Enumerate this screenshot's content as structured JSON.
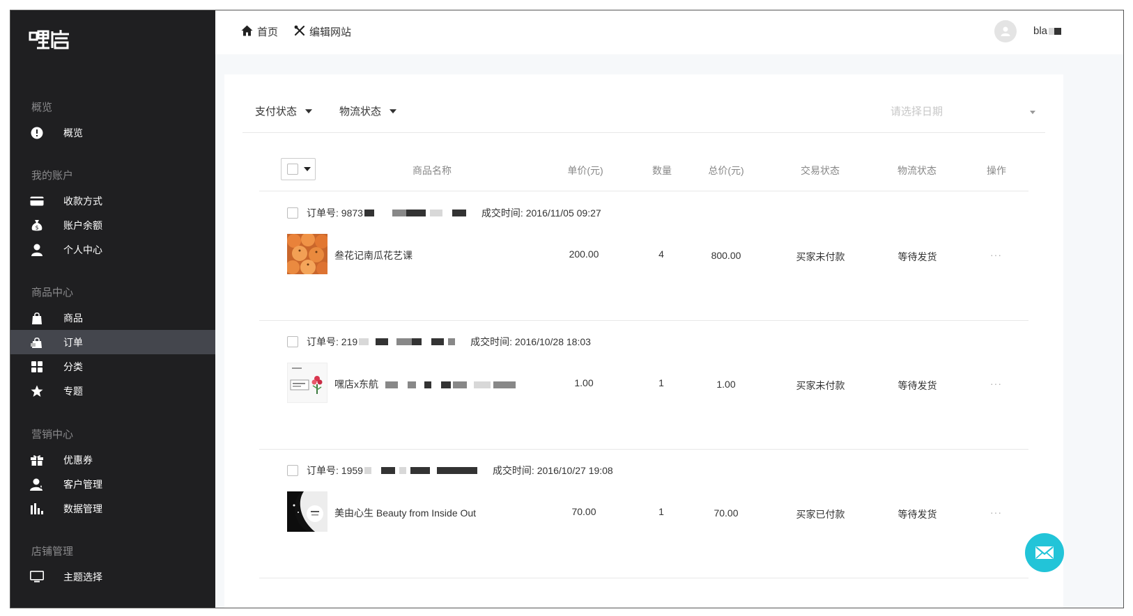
{
  "brand": {
    "logo_text": "嘿店"
  },
  "sidebar": {
    "sections": [
      {
        "title": "概览",
        "items": [
          {
            "label": "概览",
            "icon": "info-icon"
          }
        ]
      },
      {
        "title": "我的账户",
        "items": [
          {
            "label": "收款方式",
            "icon": "card-icon"
          },
          {
            "label": "账户余额",
            "icon": "money-bag-icon"
          },
          {
            "label": "个人中心",
            "icon": "user-icon"
          }
        ]
      },
      {
        "title": "商品中心",
        "items": [
          {
            "label": "商品",
            "icon": "shopping-bag-icon"
          },
          {
            "label": "订单",
            "icon": "orders-icon",
            "active": true
          },
          {
            "label": "分类",
            "icon": "grid-icon"
          },
          {
            "label": "专题",
            "icon": "star-icon"
          }
        ]
      },
      {
        "title": "营销中心",
        "items": [
          {
            "label": "优惠券",
            "icon": "gift-icon"
          },
          {
            "label": "客户管理",
            "icon": "customers-icon"
          },
          {
            "label": "数据管理",
            "icon": "bar-chart-icon"
          }
        ]
      },
      {
        "title": "店铺管理",
        "items": [
          {
            "label": "主题选择",
            "icon": "monitor-icon"
          }
        ]
      }
    ]
  },
  "topbar": {
    "home_label": "首页",
    "edit_label": "编辑网站",
    "username": "bla"
  },
  "filters": {
    "payment_status": "支付状态",
    "shipping_status": "物流状态",
    "date_placeholder": "请选择日期"
  },
  "table": {
    "headers": {
      "name": "商品名称",
      "unit_price": "单价(元)",
      "qty": "数量",
      "total": "总价(元)",
      "trade_status": "交易状态",
      "ship_status": "物流状态",
      "actions": "操作"
    }
  },
  "orders": [
    {
      "order_no_label": "订单号: 9873",
      "time_label": "成交时间: 2016/11/05 09:27",
      "product": "叁花记南瓜花艺课",
      "unit_price": "200.00",
      "qty": "4",
      "total": "800.00",
      "trade_status": "买家未付款",
      "ship_status": "等待发货",
      "more": "···"
    },
    {
      "order_no_label": "订单号: 219",
      "time_label": "成交时间: 2016/10/28 18:03",
      "product": "嘿店x东航",
      "unit_price": "1.00",
      "qty": "1",
      "total": "1.00",
      "trade_status": "买家未付款",
      "ship_status": "等待发货",
      "more": "···"
    },
    {
      "order_no_label": "订单号: 1959",
      "time_label": "成交时间: 2016/10/27 19:08",
      "product": "美由心生 Beauty from Inside Out",
      "unit_price": "70.00",
      "qty": "1",
      "total": "70.00",
      "trade_status": "买家已付款",
      "ship_status": "等待发货",
      "more": "···"
    }
  ],
  "colors": {
    "sidebar_bg": "#1f1f21",
    "sidebar_active": "#44464d",
    "fab": "#22c4d8"
  }
}
